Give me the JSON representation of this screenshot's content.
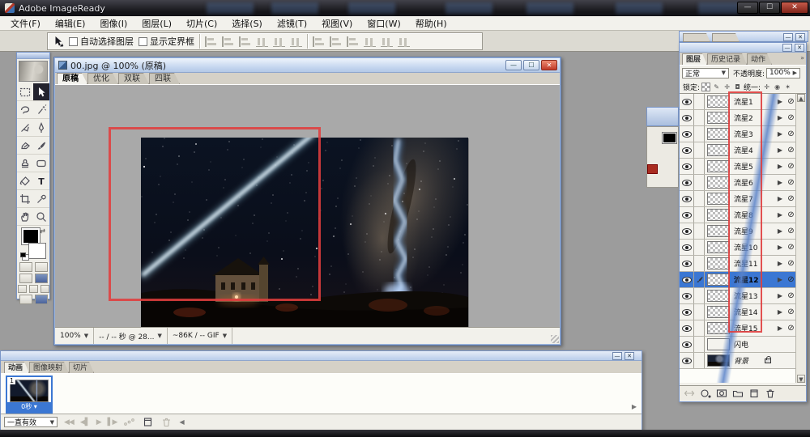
{
  "window": {
    "title": "Adobe ImageReady"
  },
  "menubar": {
    "items": [
      "文件(F)",
      "编辑(E)",
      "图像(I)",
      "图层(L)",
      "切片(C)",
      "选择(S)",
      "滤镜(T)",
      "视图(V)",
      "窗口(W)",
      "帮助(H)"
    ]
  },
  "options_bar": {
    "auto_select_layer": "自动选择图层",
    "show_bounding_box": "显示定界框"
  },
  "document": {
    "title": "00.jpg @ 100% (原稿)",
    "tabs": [
      "原稿",
      "优化",
      "双联",
      "四联"
    ],
    "active_tab": "原稿",
    "status": {
      "zoom": "100%",
      "timing": "-- / -- 秒 @ 28...",
      "size": "~86K / -- GIF"
    }
  },
  "layers_panel": {
    "tabs": [
      "图层",
      "历史记录",
      "动作"
    ],
    "blend_mode": "正常",
    "opacity_label": "不透明度:",
    "opacity_value": "100%",
    "lock_label": "锁定:",
    "unify_label": "统一:",
    "selected_layer": "流星12",
    "layers": [
      {
        "name": "流星1",
        "thumb": "checker"
      },
      {
        "name": "流星2",
        "thumb": "checker"
      },
      {
        "name": "流星3",
        "thumb": "checker"
      },
      {
        "name": "流星4",
        "thumb": "checker"
      },
      {
        "name": "流星5",
        "thumb": "checker"
      },
      {
        "name": "流星6",
        "thumb": "checker"
      },
      {
        "name": "流星7",
        "thumb": "checker"
      },
      {
        "name": "流星8",
        "thumb": "checker"
      },
      {
        "name": "流星9",
        "thumb": "checker"
      },
      {
        "name": "流星10",
        "thumb": "checker"
      },
      {
        "name": "流星11",
        "thumb": "checker"
      },
      {
        "name": "流星12",
        "thumb": "checker",
        "selected": true
      },
      {
        "name": "流星13",
        "thumb": "checker"
      },
      {
        "name": "流星14",
        "thumb": "checker"
      },
      {
        "name": "流星15",
        "thumb": "checker"
      },
      {
        "name": "闪电",
        "thumb": "lightning",
        "icons": false
      },
      {
        "name": "背景",
        "thumb": "bgimg",
        "icons": false,
        "locked": true,
        "italic": true
      }
    ]
  },
  "animation_panel": {
    "tabs": [
      "动画",
      "图像映射",
      "切片"
    ],
    "frame": {
      "number": "1",
      "delay": "0秒"
    },
    "loop": "一直有效"
  },
  "colors": {
    "selection_blue": "#3b77d3",
    "annotation_red": "#e03e3e",
    "close_button_red": "#c03a28"
  }
}
